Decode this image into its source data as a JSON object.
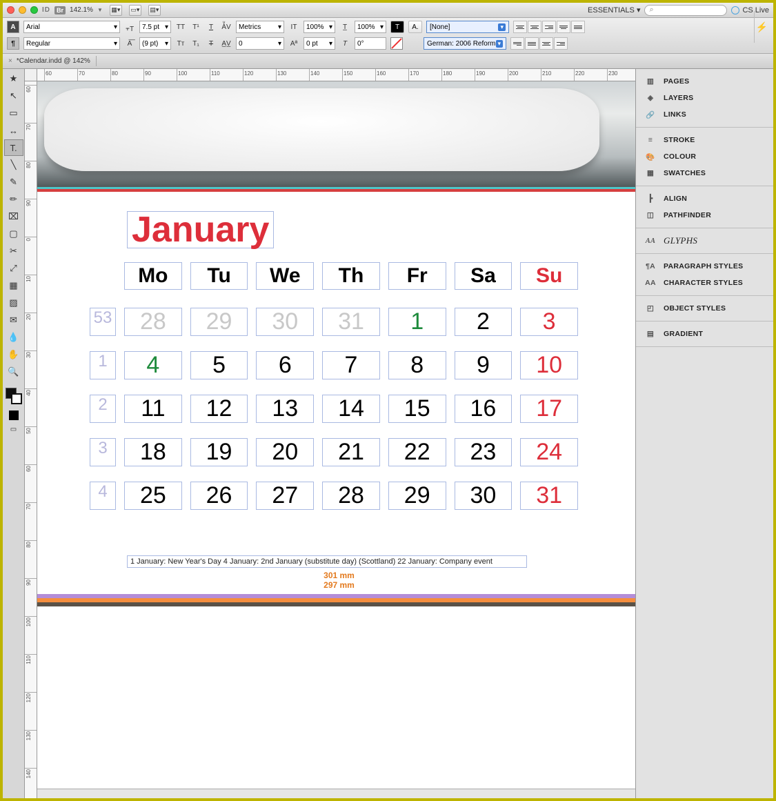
{
  "titlebar": {
    "app_id": "ID",
    "bridge": "Br",
    "zoom": "142.1%",
    "workspace": "ESSENTIALS ▾",
    "cslive": "CS Live"
  },
  "controlbar": {
    "mode_char": "A",
    "mode_para": "¶",
    "font_family": "Arial",
    "font_style": "Regular",
    "font_size": "7.5 pt",
    "leading": "(9 pt)",
    "kerning": "Metrics",
    "tracking": "0",
    "hscale": "100%",
    "vscale": "100%",
    "baseline": "0 pt",
    "char_style": "[None]",
    "language": "German: 2006 Reform"
  },
  "doctab": {
    "label": "*Calendar.indd @ 142%"
  },
  "tools": [
    "selection",
    "direct",
    "page",
    "gap",
    "type",
    "line",
    "pen",
    "pencil",
    "rect-frame",
    "rect",
    "scissors",
    "free-transform",
    "gradient-swatch",
    "gradient-feather",
    "note",
    "eyedropper",
    "hand",
    "zoom"
  ],
  "ruler_h": [
    "60",
    "70",
    "80",
    "90",
    "100",
    "110",
    "120",
    "130",
    "140",
    "150",
    "160",
    "170",
    "180",
    "190",
    "200",
    "210",
    "220",
    "230"
  ],
  "ruler_v": [
    "60",
    "70",
    "80",
    "90",
    "0",
    "10",
    "20",
    "30",
    "40",
    "50",
    "60",
    "70",
    "80",
    "90",
    "100",
    "110",
    "120",
    "130",
    "140"
  ],
  "calendar": {
    "month_title": "January",
    "weekdays": [
      "Mo",
      "Tu",
      "We",
      "Th",
      "Fr",
      "Sa",
      "Su"
    ],
    "rows": [
      {
        "wn": "53",
        "cells": [
          {
            "n": "28",
            "cls": "prev"
          },
          {
            "n": "29",
            "cls": "prev"
          },
          {
            "n": "30",
            "cls": "prev"
          },
          {
            "n": "31",
            "cls": "prev"
          },
          {
            "n": "1",
            "cls": "holiday"
          },
          {
            "n": "2",
            "cls": "w"
          },
          {
            "n": "3",
            "cls": "su"
          }
        ]
      },
      {
        "wn": "1",
        "cells": [
          {
            "n": "4",
            "cls": "holiday"
          },
          {
            "n": "5",
            "cls": "w"
          },
          {
            "n": "6",
            "cls": "w"
          },
          {
            "n": "7",
            "cls": "w"
          },
          {
            "n": "8",
            "cls": "w"
          },
          {
            "n": "9",
            "cls": "w"
          },
          {
            "n": "10",
            "cls": "su"
          }
        ]
      },
      {
        "wn": "2",
        "cells": [
          {
            "n": "11",
            "cls": "w"
          },
          {
            "n": "12",
            "cls": "w"
          },
          {
            "n": "13",
            "cls": "w"
          },
          {
            "n": "14",
            "cls": "w"
          },
          {
            "n": "15",
            "cls": "w"
          },
          {
            "n": "16",
            "cls": "w"
          },
          {
            "n": "17",
            "cls": "su"
          }
        ]
      },
      {
        "wn": "3",
        "cells": [
          {
            "n": "18",
            "cls": "w"
          },
          {
            "n": "19",
            "cls": "w"
          },
          {
            "n": "20",
            "cls": "w"
          },
          {
            "n": "21",
            "cls": "w"
          },
          {
            "n": "22",
            "cls": "w"
          },
          {
            "n": "23",
            "cls": "w"
          },
          {
            "n": "24",
            "cls": "su"
          }
        ]
      },
      {
        "wn": "4",
        "cells": [
          {
            "n": "25",
            "cls": "w"
          },
          {
            "n": "26",
            "cls": "w"
          },
          {
            "n": "27",
            "cls": "w"
          },
          {
            "n": "28",
            "cls": "w"
          },
          {
            "n": "29",
            "cls": "w"
          },
          {
            "n": "30",
            "cls": "w"
          },
          {
            "n": "31",
            "cls": "su"
          }
        ]
      }
    ],
    "events": "1 January: New Year's Day   4 January: 2nd January (substitute day) (Scottland)   22 January: Company event",
    "guide1": "301 mm",
    "guide2": "297 mm"
  },
  "right_panels": [
    {
      "group": [
        {
          "icon": "pages-icon",
          "label": "PAGES"
        },
        {
          "icon": "layers-icon",
          "label": "LAYERS"
        },
        {
          "icon": "links-icon",
          "label": "LINKS"
        }
      ]
    },
    {
      "group": [
        {
          "icon": "stroke-icon",
          "label": "STROKE"
        },
        {
          "icon": "colour-icon",
          "label": "COLOUR"
        },
        {
          "icon": "swatches-icon",
          "label": "SWATCHES"
        }
      ]
    },
    {
      "group": [
        {
          "icon": "align-icon",
          "label": "ALIGN"
        },
        {
          "icon": "pathfinder-icon",
          "label": "PATHFINDER"
        }
      ]
    },
    {
      "group": [
        {
          "icon": "glyphs-icon",
          "label": "GLYPHS",
          "glyph": true
        }
      ]
    },
    {
      "group": [
        {
          "icon": "para-styles-icon",
          "label": "PARAGRAPH STYLES"
        },
        {
          "icon": "char-styles-icon",
          "label": "CHARACTER STYLES"
        }
      ]
    },
    {
      "group": [
        {
          "icon": "obj-styles-icon",
          "label": "OBJECT STYLES"
        }
      ]
    },
    {
      "group": [
        {
          "icon": "gradient-icon",
          "label": "GRADIENT"
        }
      ]
    }
  ]
}
